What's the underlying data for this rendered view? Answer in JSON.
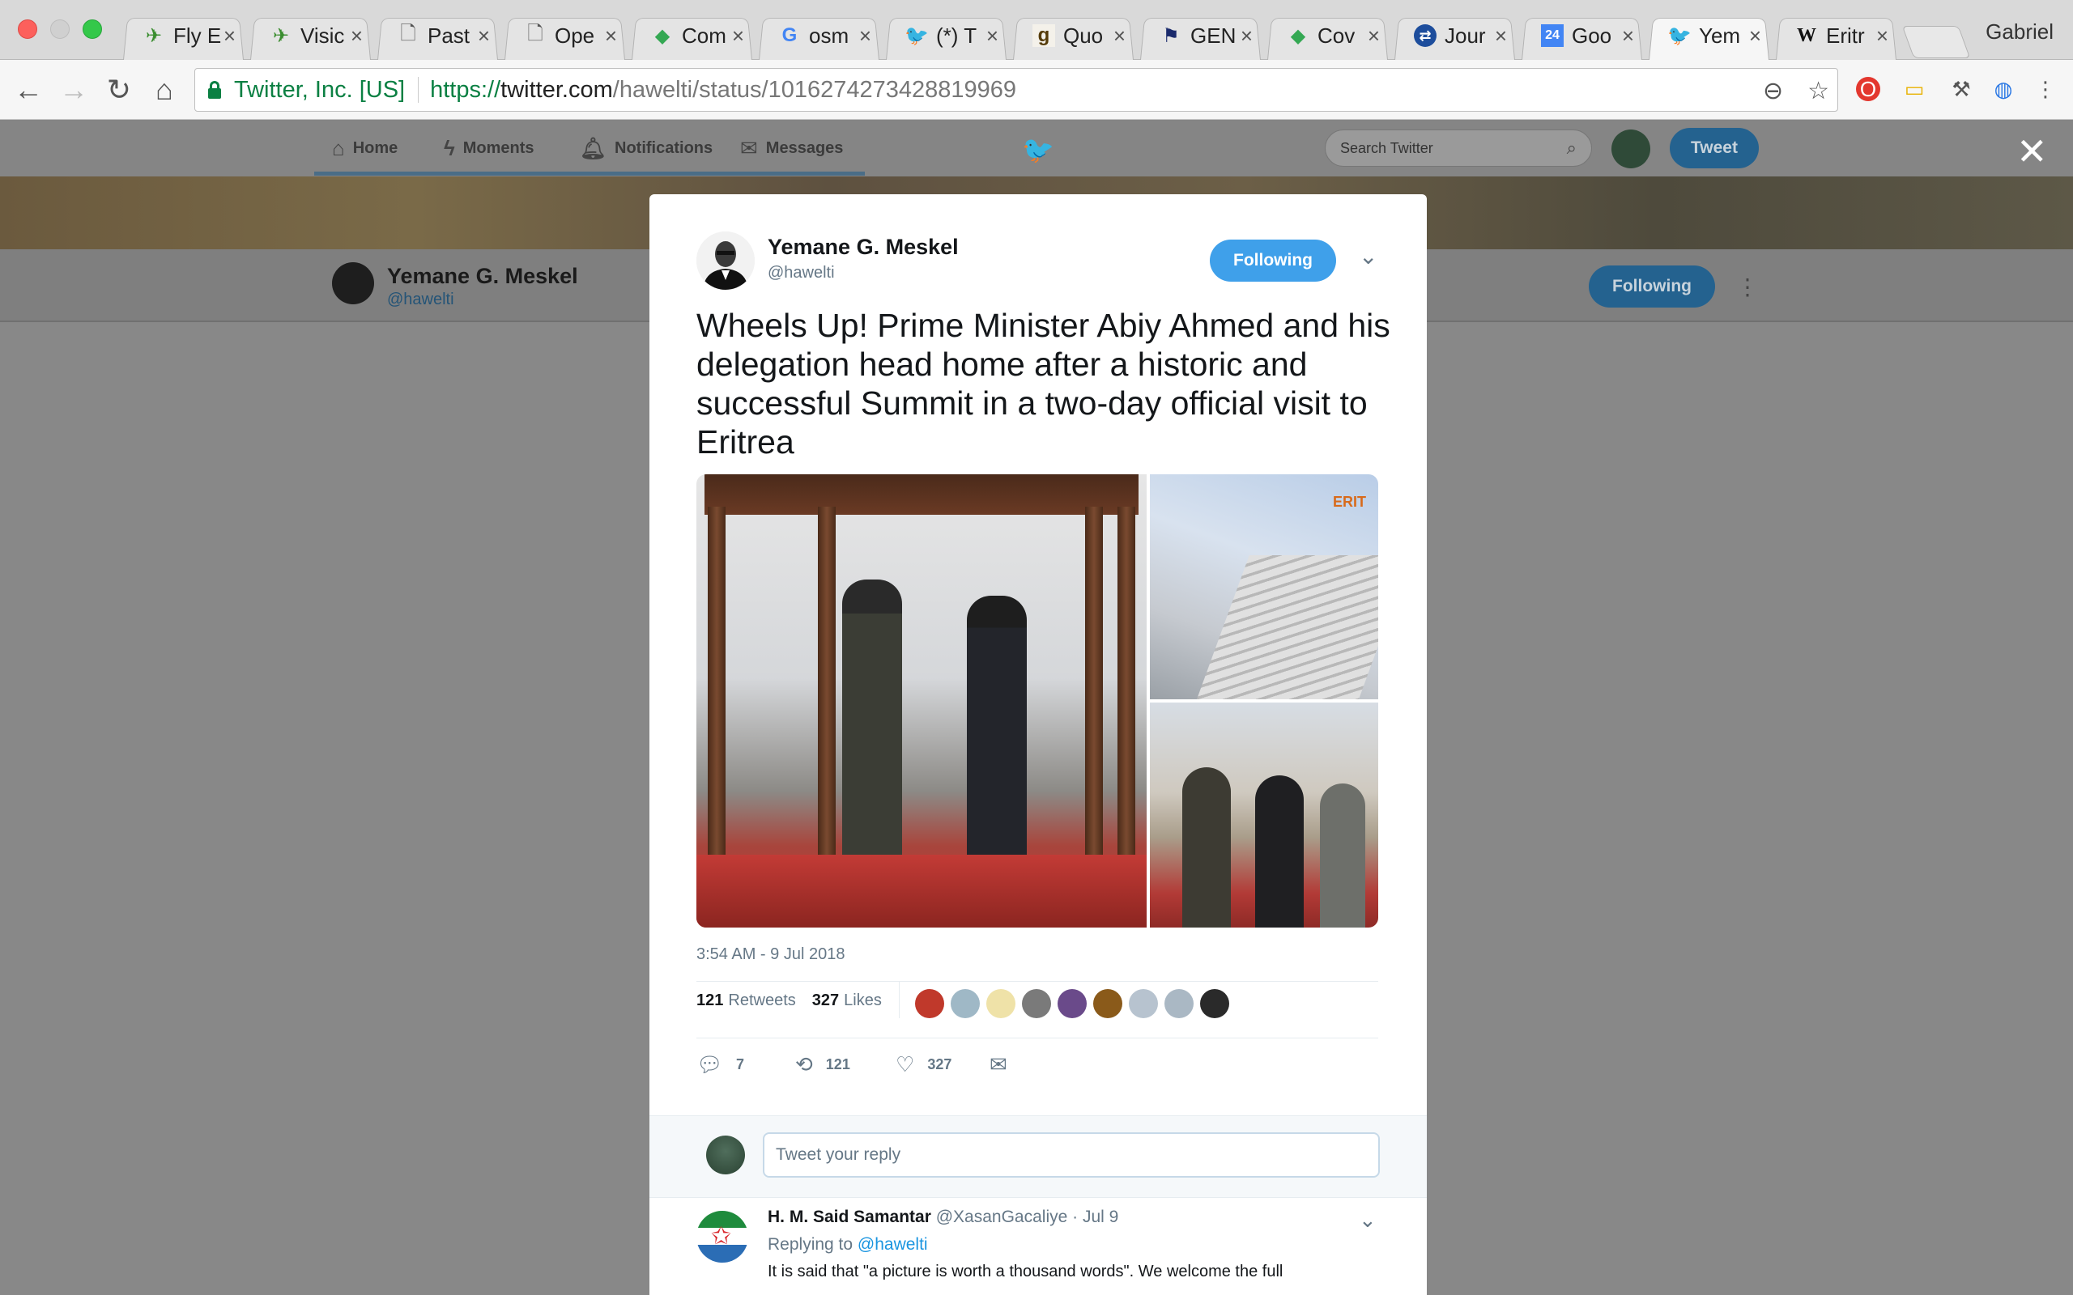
{
  "browser": {
    "profile_name": "Gabriel",
    "tabs": [
      {
        "label": "Fly E",
        "icon": "ethiopian-airlines-icon"
      },
      {
        "label": "Visic",
        "icon": "ethiopian-airlines-icon"
      },
      {
        "label": "Past",
        "icon": "page-icon"
      },
      {
        "label": "Ope",
        "icon": "page-icon"
      },
      {
        "label": "Com",
        "icon": "google-maps-icon"
      },
      {
        "label": "osm",
        "icon": "google-icon"
      },
      {
        "label": "(*) T",
        "icon": "twitter-icon"
      },
      {
        "label": "Quo",
        "icon": "goodreads-icon"
      },
      {
        "label": "GEN",
        "icon": "flag-icon"
      },
      {
        "label": "Cov",
        "icon": "google-maps-icon"
      },
      {
        "label": "Jour",
        "icon": "national-rail-icon"
      },
      {
        "label": "Goo",
        "icon": "google-calendar-icon"
      },
      {
        "label": "Yem",
        "icon": "twitter-icon",
        "active": true
      },
      {
        "label": "Eritr",
        "icon": "wikipedia-icon"
      }
    ],
    "site_identity": "Twitter, Inc. [US]",
    "url": {
      "scheme": "https://",
      "host": "twitter.com",
      "path": "/hawelti/status/1016274273428819969"
    }
  },
  "twitter_nav": {
    "home": "Home",
    "moments": "Moments",
    "notifications": "Notifications",
    "messages": "Messages",
    "search_placeholder": "Search Twitter",
    "tweet_button": "Tweet"
  },
  "profile_bar": {
    "name": "Yemane G. Meskel",
    "handle": "@hawelti",
    "follow_state": "Following"
  },
  "tweet": {
    "author_name": "Yemane G. Meskel",
    "author_handle": "@hawelti",
    "follow_state": "Following",
    "text": "Wheels Up! Prime Minister Abiy Ahmed and his delegation head home after a historic and successful Summit in a two-day official visit to Eritrea",
    "timestamp": "3:54 AM - 9 Jul 2018",
    "retweets_count": "121",
    "retweets_label": "Retweets",
    "likes_count": "327",
    "likes_label": "Likes",
    "actions": {
      "replies": "7",
      "retweets": "121",
      "likes": "327"
    },
    "media_watermark": "ERIT"
  },
  "reply_box": {
    "placeholder": "Tweet your reply"
  },
  "reply": {
    "author_name": "H. M. Said Samantar",
    "author_handle": "@XasanGacaliye",
    "date": "· Jul 9",
    "replying_to_label": "Replying to",
    "replying_to_handle": "@hawelti",
    "text": "It is said that \"a picture is worth a thousand words\". We welcome the full"
  },
  "colors": {
    "twitter_blue": "#1da1f2",
    "follow_button": "#3fa0ea",
    "secure_green": "#0b8043"
  }
}
